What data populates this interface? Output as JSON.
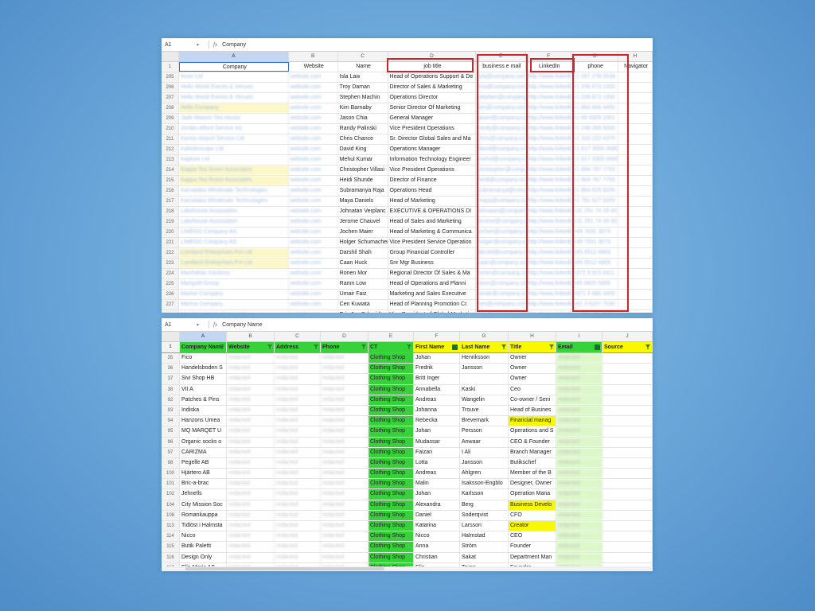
{
  "sheet1": {
    "cell_ref": "A1",
    "formula": "Company",
    "columns": [
      "A",
      "B",
      "C",
      "D",
      "E",
      "F",
      "G",
      "H"
    ],
    "headers": [
      "Company",
      "Website",
      "Name",
      "job title",
      "business e mail",
      "LinkedIn",
      "phone",
      "Navigator"
    ],
    "rows": [
      {
        "n": "205",
        "company": "Anon Ltd",
        "website": "website.com",
        "name": "Isla Law",
        "title": "Head of Operations Support & De",
        "email": "isla@company.com",
        "linkedin": "http://www.linkedin.com",
        "phone": "+1 267 278 5539"
      },
      {
        "n": "206",
        "company": "Hello World Events & Venues",
        "website": "website.com",
        "name": "Troy Daman",
        "title": "Director of Sales & Marketing",
        "email": "troy@company.com",
        "linkedin": "http://www.linkedin.com",
        "phone": "+1 206 673 1330"
      },
      {
        "n": "207",
        "company": "Hello World Events & Venues",
        "website": "website.com",
        "name": "Stephen Machin",
        "title": "Operations Director",
        "email": "stephen@company.com",
        "linkedin": "http://www.linkedin.com",
        "phone": "+1 206 673 1330"
      },
      {
        "n": "208",
        "company": "Hello Company",
        "website": "website.com",
        "name": "Kim Barnaby",
        "title": "Senior Director Of Marketing",
        "email": "kim@company.com",
        "linkedin": "http://www.linkedin.com",
        "phone": "+1 864 606 4400"
      },
      {
        "n": "209",
        "company": "Jade Maison Tea House",
        "website": "website.com",
        "name": "Jason Chia",
        "title": "General Manager",
        "email": "jason@company.com",
        "linkedin": "http://www.linkedin.com",
        "phone": "+1 65 6305 1001"
      },
      {
        "n": "210",
        "company": "Jordan Alford Service Inc",
        "website": "website.com",
        "name": "Randy Palinski",
        "title": "Vice President Operations",
        "email": "randy@company.com",
        "linkedin": "http://www.linkedin.com",
        "phone": "+1 248 356 5000"
      },
      {
        "n": "211",
        "company": "Kantor Airport Service Ltd",
        "website": "website.com",
        "name": "Chris Chance",
        "title": "Sr. Director Global Sales and Ma",
        "email": "chris@company.com",
        "linkedin": "http://www.linkedin.com",
        "phone": "+1 310 222 4375"
      },
      {
        "n": "212",
        "company": "Kaleidoscope Ltd",
        "website": "website.com",
        "name": "David King",
        "title": "Operations Manager",
        "email": "david@company.com",
        "linkedin": "http://www.linkedin.com",
        "phone": "+1 617 3555 0680"
      },
      {
        "n": "213",
        "company": "Kapture Ltd",
        "website": "website.com",
        "name": "Mehul Kumar",
        "title": "Information Technology Engineer",
        "email": "mehul@company.com",
        "linkedin": "http://www.linkedin.com",
        "phone": "+1 617 3355 0680"
      },
      {
        "n": "214",
        "company": "Kappa Tea Room Associates",
        "website": "website.com",
        "name": "Christopher Villasi",
        "title": "Vice President Operations",
        "email": "christopher@company.com",
        "linkedin": "http://www.linkedin.com",
        "phone": "+1 864 787 7755"
      },
      {
        "n": "215",
        "company": "Kappa Tea Room Associates",
        "website": "website.com",
        "name": "Heidi Shunde",
        "title": "Director of Finance",
        "email": "heidi@company.com",
        "linkedin": "http://www.linkedin.com",
        "phone": "+1 864 787 7755"
      },
      {
        "n": "216",
        "company": "Karnataka Wholesale Technologies",
        "website": "website.com",
        "name": "Subramanya Raja",
        "title": "Operations Head",
        "email": "subramanya@company.com",
        "linkedin": "http://www.linkedin.com",
        "phone": "+1 864 625 6200"
      },
      {
        "n": "217",
        "company": "Karnataka Wholesale Technologies",
        "website": "website.com",
        "name": "Maya Daniels",
        "title": "Head of Marketing",
        "email": "maya@company.com",
        "linkedin": "http://www.linkedin.com",
        "phone": "+1 791 627 6200"
      },
      {
        "n": "218",
        "company": "Lakehouse Association",
        "website": "website.com",
        "name": "Johnatan Verplanc",
        "title": "EXECUTIVE & OPERATIONS DI",
        "email": "johnatan@company.com",
        "linkedin": "http://www.linkedin.com",
        "phone": "+31 251 74 33 00"
      },
      {
        "n": "219",
        "company": "Lakehouse Association",
        "website": "website.com",
        "name": "Jerome Chauvel",
        "title": "Head of Sales and Marketing",
        "email": "jerome@company.com",
        "linkedin": "http://www.linkedin.com",
        "phone": "+31 251 74 33 00"
      },
      {
        "n": "220",
        "company": "LIMEGO Company AG",
        "website": "website.com",
        "name": "Jochen Maier",
        "title": "Head of Marketing & Communica",
        "email": "jochen@company.com",
        "linkedin": "http://www.linkedin.com",
        "phone": "+49 7031 3073"
      },
      {
        "n": "221",
        "company": "LIMEGO Company AG",
        "website": "website.com",
        "name": "Holger Schumacher",
        "title": "Vice President Service Operation",
        "email": "holger@company.com",
        "linkedin": "http://www.linkedin.com",
        "phone": "+49 7031 3073"
      },
      {
        "n": "222",
        "company": "Lumiland Enterprises Pvt Ltd",
        "website": "website.com",
        "name": "Darshil Shah",
        "title": "Group Financial Controller",
        "email": "darshil@company.com",
        "linkedin": "http://www.linkedin.com",
        "phone": "+65 6512 6909"
      },
      {
        "n": "223",
        "company": "Lumiland Enterprises Pvt Ltd",
        "website": "website.com",
        "name": "Caan Huck",
        "title": "Snr Mgr Business",
        "email": "caan@company.com",
        "linkedin": "http://www.linkedin.com",
        "phone": "+65 6512 6909"
      },
      {
        "n": "224",
        "company": "Manhattan Kitchens",
        "website": "website.com",
        "name": "Ronen Mor",
        "title": "Regional Director Of Sales & Ma",
        "email": "ronen@company.com",
        "linkedin": "http://www.linkedin.com",
        "phone": "+972 9 915 0411"
      },
      {
        "n": "225",
        "company": "Marigold Group",
        "website": "website.com",
        "name": "Ramn Low",
        "title": "Head of Operations and Planni",
        "email": "ramn@company.com",
        "linkedin": "http://www.linkedin.com",
        "phone": "+65 6600 6400"
      },
      {
        "n": "226",
        "company": "Marine Company",
        "website": "website.com",
        "name": "Umair Faiz",
        "title": "Marketing and Sales Executive",
        "email": "umair@company.com",
        "linkedin": "http://www.linkedin.com",
        "phone": "+971 4 880 4400"
      },
      {
        "n": "227",
        "company": "Marina Company",
        "website": "website.com",
        "name": "Cen Kuwata",
        "title": "Head of Planning Promotion Cr.",
        "email": "cen@company.com",
        "linkedin": "http://www.linkedin.com",
        "phone": "+81 3 6207 7030"
      },
      {
        "n": "228",
        "company": "Meridian Hotels Group Ltd",
        "website": "website.com",
        "name": "Eric Jan Schmidt",
        "title": "Vice President of Global Marketin",
        "email": "eric@company.com",
        "linkedin": "http://www.linkedin.com",
        "phone": "+1 301 791 5500"
      },
      {
        "n": "229",
        "company": "Meridian Hotels Group Ltd",
        "website": "website.com",
        "name": "Hillary Walker",
        "title": "Operations Lead",
        "email": "hillary@company.com",
        "linkedin": "http://www.linkedin.com",
        "phone": "+1 301 791 5500"
      }
    ]
  },
  "sheet2": {
    "cell_ref": "A1",
    "formula": "Company Name",
    "columns": [
      "A",
      "B",
      "C",
      "D",
      "E",
      "F",
      "G",
      "H",
      "I",
      "J"
    ],
    "headers": [
      "Company Name",
      "Website",
      "Address",
      "Phone",
      "CT",
      "First Name",
      "Last Name",
      "Title",
      "Email",
      "Source"
    ],
    "rows": [
      {
        "n": "35",
        "company": "Fico",
        "ct": "Clothing Shop",
        "first": "Johan",
        "last": "Henriksson",
        "title": "Owner"
      },
      {
        "n": "36",
        "company": "Handelsboden S",
        "ct": "Clothing Shop",
        "first": "Fredrik",
        "last": "Jansson",
        "title": "Owner"
      },
      {
        "n": "37",
        "company": "Sivi Shop HB",
        "ct": "Clothing Shop",
        "first": "Britt Inger",
        "last": "",
        "title": "Owner"
      },
      {
        "n": "38",
        "company": "VII A",
        "ct": "Clothing Shop",
        "first": "Annabella",
        "last": "Kaski",
        "title": "Ceo"
      },
      {
        "n": "92",
        "company": "Patches & Pins",
        "ct": "Clothing Shop",
        "first": "Andreas",
        "last": "Wangelin",
        "title": "Co-owner / Seni"
      },
      {
        "n": "93",
        "company": "Indiska",
        "ct": "Clothing Shop",
        "first": "Johanna",
        "last": "Trouve",
        "title": "Head of Busines"
      },
      {
        "n": "94",
        "company": "Hanzons Umea",
        "ct": "Clothing Shop",
        "first": "Rebecka",
        "last": "Brevemark",
        "title": "Financial manag"
      },
      {
        "n": "95",
        "company": "MQ MARQET U",
        "ct": "Clothing Shop",
        "first": "Johan",
        "last": "Persson",
        "title": "Operations and S"
      },
      {
        "n": "96",
        "company": "Organic socks o",
        "ct": "Clothing Shop",
        "first": "Mudassar",
        "last": "Anwaar",
        "title": "CEO & Founder"
      },
      {
        "n": "97",
        "company": "CARIZMA",
        "ct": "Clothing Shop",
        "first": "Faizan",
        "last": "I Ali",
        "title": "Branch Manager"
      },
      {
        "n": "98",
        "company": "Pegelle AB",
        "ct": "Clothing Shop",
        "first": "Lotta",
        "last": "Jansson",
        "title": "Butikschef"
      },
      {
        "n": "100",
        "company": "Hjärtero AB",
        "ct": "Clothing Shop",
        "first": "Andreas",
        "last": "Ahlgren",
        "title": "Member of the B"
      },
      {
        "n": "101",
        "company": "Bric-a-brac",
        "ct": "Clothing Shop",
        "first": "Malin",
        "last": "Isaksson-Engblo",
        "title": "Designer, Owner"
      },
      {
        "n": "102",
        "company": "Jehnells",
        "ct": "Clothing Shop",
        "first": "Johan",
        "last": "Karlsson",
        "title": "Operation Mana"
      },
      {
        "n": "104",
        "company": "City Mission Soc",
        "ct": "Clothing Shop",
        "first": "Alexandra",
        "last": "Berg",
        "title": "Business Develo"
      },
      {
        "n": "108",
        "company": "Romankauppa",
        "ct": "Clothing Shop",
        "first": "Daniel",
        "last": "Soderqvist",
        "title": "CFO"
      },
      {
        "n": "113",
        "company": "Tidlöst i Halmsta",
        "ct": "Clothing Shop",
        "first": "Katarina",
        "last": "Larsson",
        "title": "Creator"
      },
      {
        "n": "114",
        "company": "Nicco",
        "ct": "Clothing Shop",
        "first": "Nicco",
        "last": "Halmstad",
        "title": "CEO"
      },
      {
        "n": "115",
        "company": "Butik Paletti",
        "ct": "Clothing Shop",
        "first": "Anna",
        "last": "Ström",
        "title": "Founder"
      },
      {
        "n": "116",
        "company": "Design Only",
        "ct": "Clothing Shop",
        "first": "Christian",
        "last": "Sakat",
        "title": "Department Man"
      },
      {
        "n": "117",
        "company": "Elin Maria AB",
        "ct": "Clothing Shop",
        "first": "Elin",
        "last": "Trygg",
        "title": "Founder"
      }
    ],
    "blur_text": "redacted",
    "highlight_rows": [
      "94",
      "104",
      "113"
    ]
  },
  "colors": {
    "green": "#37d13a",
    "yellow": "#f8f800",
    "red": "#d3232a"
  }
}
